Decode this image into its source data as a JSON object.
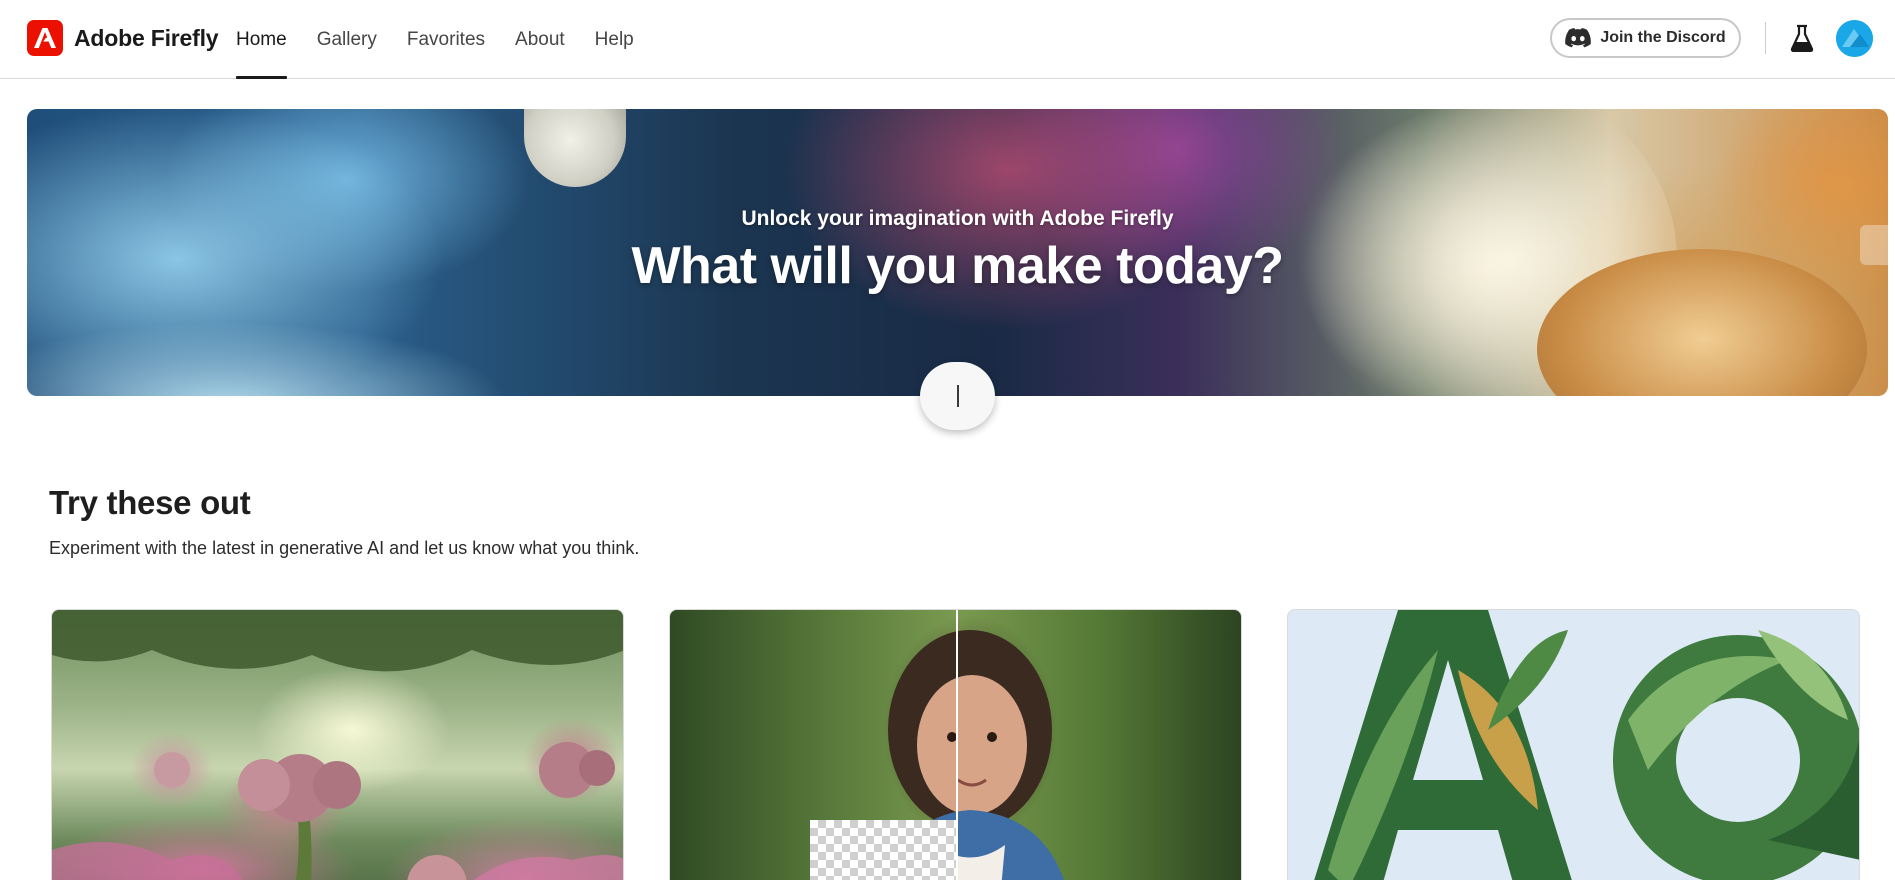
{
  "brand": {
    "name": "Adobe Firefly",
    "logo_icon": "adobe-logo-icon",
    "logo_color": "#eb1000"
  },
  "nav": {
    "tabs": [
      {
        "label": "Home",
        "active": true
      },
      {
        "label": "Gallery",
        "active": false
      },
      {
        "label": "Favorites",
        "active": false
      },
      {
        "label": "About",
        "active": false
      },
      {
        "label": "Help",
        "active": false
      }
    ]
  },
  "header_actions": {
    "discord_label": "Join the Discord",
    "discord_icon": "discord-icon",
    "beaker_icon": "beaker-icon",
    "avatar_color": "#1aa7e8"
  },
  "hero": {
    "subtitle": "Unlock your imagination with Adobe Firefly",
    "title": "What will you make today?"
  },
  "try_section": {
    "title": "Try these out",
    "description": "Experiment with the latest in generative AI and let us know what you think."
  }
}
